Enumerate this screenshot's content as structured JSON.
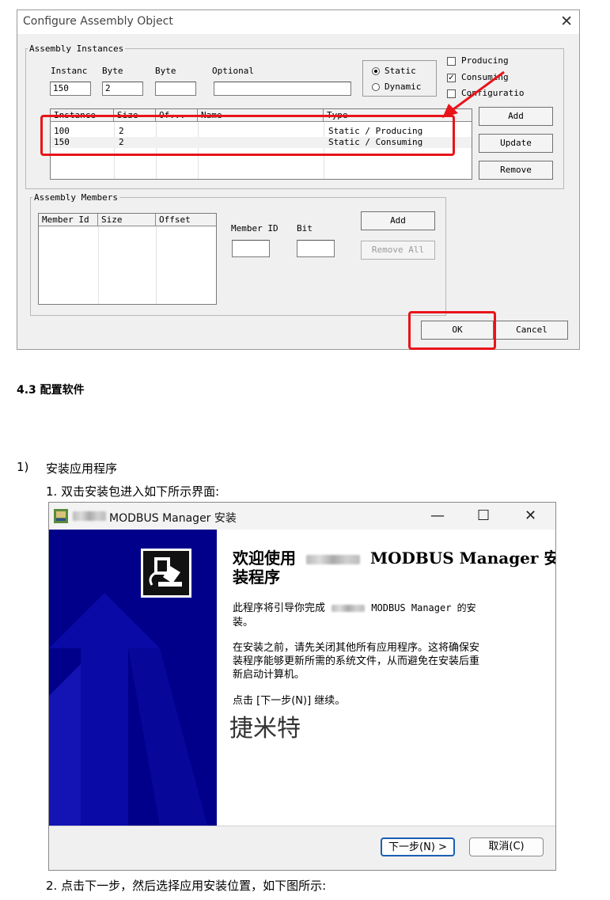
{
  "dialog1": {
    "title": "Configure Assembly Object",
    "close_glyph": "✕",
    "instances_group": "Assembly Instances",
    "fields": {
      "instance_label": "Instanc",
      "byte1_label": "Byte",
      "byte2_label": "Byte",
      "optional_label": "Optional",
      "instance_value": "150",
      "byte1_value": "2",
      "byte2_value": "",
      "optional_value": ""
    },
    "radios": {
      "static": "Static",
      "dynamic": "Dynamic",
      "selected": "static"
    },
    "checkboxes": {
      "producing": {
        "label": "Producing",
        "checked": false
      },
      "consuming": {
        "label": "Consuming",
        "checked": true
      },
      "configuration": {
        "label": "Configuratio",
        "checked": false
      }
    },
    "instances_table": {
      "columns": [
        "Instance",
        "Size",
        "Of...",
        "Name",
        "Type"
      ],
      "rows": [
        [
          "100",
          "2",
          "",
          "",
          "Static / Producing"
        ],
        [
          "150",
          "2",
          "",
          "",
          "Static / Consuming"
        ]
      ]
    },
    "instance_buttons": {
      "add": "Add",
      "update": "Update",
      "remove": "Remove"
    },
    "members_group": "Assembly Members",
    "members_table": {
      "columns": [
        "Member Id",
        "Size",
        "Offset"
      ]
    },
    "member_fields": {
      "member_id_label": "Member ID",
      "bit_label": "Bit",
      "member_id_value": "",
      "bit_value": ""
    },
    "member_buttons": {
      "add": "Add",
      "remove_all": "Remove All"
    },
    "ok": "OK",
    "cancel": "Cancel"
  },
  "doc": {
    "section_heading": "4.3 配置软件",
    "step_number": "1)",
    "step_title": "安装应用程序",
    "substep1": "1. 双击安装包进入如下所示界面:",
    "substep2": "2. 点击下一步，然后选择应用安装位置，如下图所示:"
  },
  "dialog2": {
    "title": "MODBUS Manager 安装",
    "heading_line1": "欢迎使用",
    "heading_product": "MODBUS Manager 安",
    "heading_line2": "装程序",
    "para1_prefix": "此程序将引导你完成",
    "para1_product": "MODBUS Manager 的安",
    "para1_line2": "装。",
    "para2_line1": "在安装之前，请先关闭其他所有应用程序。这将确保安",
    "para2_line2": "装程序能够更新所需的系统文件，从而避免在安装后重",
    "para2_line3": "新启动计算机。",
    "para3": "点击 [下一步(N)] 继续。",
    "watermark": "捷米特",
    "next_button": "下一步(N) >",
    "cancel_button": "取消(C)",
    "minimize_glyph": "—",
    "maximize_glyph": "☐",
    "close_glyph": "✕"
  },
  "colors": {
    "highlight_red": "#e8141a",
    "installer_side": "#00008b"
  }
}
